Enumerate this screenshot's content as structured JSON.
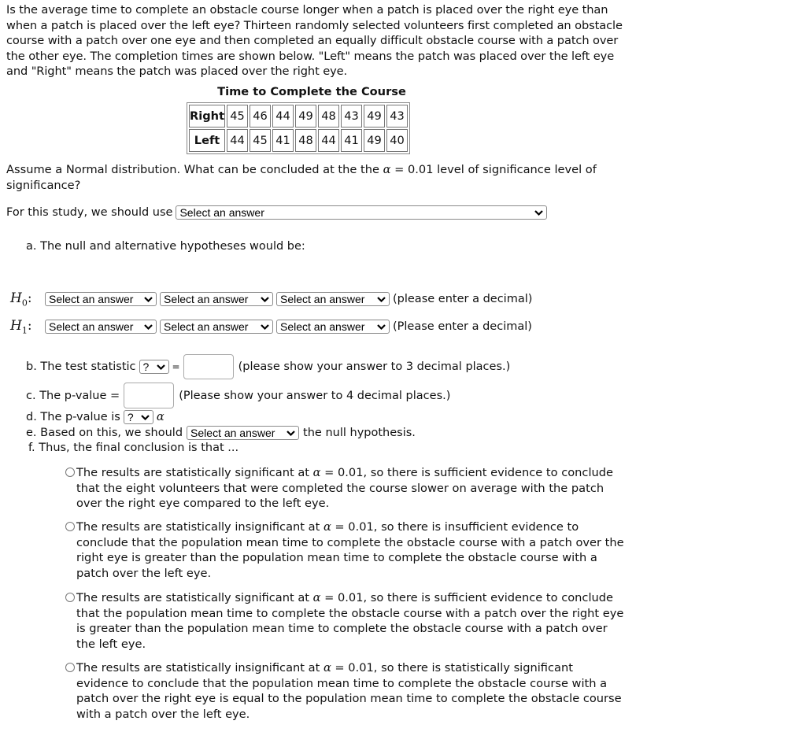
{
  "question": {
    "intro": "Is the average time to complete an obstacle course longer when a patch is placed over the right eye than when a patch is placed over the left eye? Thirteen randomly selected volunteers first completed an obstacle course with a patch over one eye and then completed an equally difficult obstacle course with a patch over the other eye. The completion times are shown below. \"Left\" means the patch was placed over the left eye and \"Right\" means the patch was placed over the right eye.",
    "table": {
      "title": "Time to Complete the Course",
      "rows": [
        {
          "label": "Right",
          "values": [
            "45",
            "46",
            "44",
            "49",
            "48",
            "43",
            "49",
            "43"
          ]
        },
        {
          "label": "Left",
          "values": [
            "44",
            "45",
            "41",
            "48",
            "44",
            "41",
            "49",
            "40"
          ]
        }
      ]
    },
    "assumption_pre": "Assume a Normal distribution.  What can be concluded at the the ",
    "alpha_symbol": "α",
    "assumption_post": " = 0.01 level of significance level of significance?"
  },
  "study": {
    "label": "For this study, we should use",
    "select_value": "Select an answer"
  },
  "part_a": {
    "label": "a. The null and alternative hypotheses would be:",
    "h0": {
      "symbol": "H",
      "sub": "0",
      "colon": ":",
      "selects": [
        "Select an answer",
        "Select an answer",
        "Select an answer"
      ],
      "hint": "(please enter a decimal)"
    },
    "h1": {
      "symbol": "H",
      "sub": "1",
      "colon": ":",
      "selects": [
        "Select an answer",
        "Select an answer",
        "Select an answer"
      ],
      "hint": "(Please enter a decimal)"
    }
  },
  "part_b": {
    "label": "b. The test statistic",
    "select_value": "?",
    "equals": "=",
    "input_value": "",
    "hint": "(please show your answer to 3 decimal places.)"
  },
  "part_c": {
    "label": "c. The p-value =",
    "input_value": "",
    "hint": "(Please show your answer to 4 decimal places.)"
  },
  "part_d": {
    "label": "d. The p-value is",
    "select_value": "?",
    "alpha_symbol": "α"
  },
  "part_e": {
    "label": "e. Based on this, we should",
    "select_value": "Select an answer",
    "suffix": "the null hypothesis."
  },
  "part_f": {
    "label": "f. Thus, the final conclusion is that ..."
  },
  "options": [
    {
      "pre": "The results are statistically significant at ",
      "alpha": "α",
      "post": " = 0.01, so there is sufficient evidence to conclude that the eight volunteers that were completed the course slower on average with the patch over the right eye compared to the left eye.",
      "selected": false
    },
    {
      "pre": "The results are statistically insignificant at ",
      "alpha": "α",
      "post": " = 0.01, so there is insufficient evidence to conclude that the population mean time to complete the obstacle course with a patch over the right eye is greater than the population mean time to complete the obstacle course with a patch over the left eye.",
      "selected": false
    },
    {
      "pre": "The results are statistically significant at ",
      "alpha": "α",
      "post": " = 0.01, so there is sufficient evidence to conclude that the population mean time to complete the obstacle course with a patch over the right eye is greater than the population mean time to complete the obstacle course with a patch over the left eye.",
      "selected": false
    },
    {
      "pre": "The results are statistically insignificant at ",
      "alpha": "α",
      "post": " = 0.01, so there is statistically significant evidence to conclude that the population mean time to complete the obstacle course with a patch over the right eye is equal to the population mean time to complete the obstacle course with a patch over the left eye.",
      "selected": false
    }
  ],
  "icons": {
    "select_chevron": "chevron-down-icon",
    "radio": "radio-unchecked-icon"
  }
}
